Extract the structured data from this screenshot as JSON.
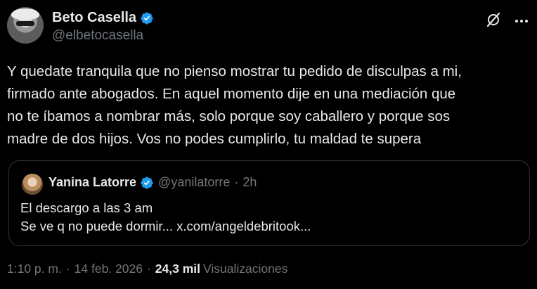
{
  "author": {
    "name": "Beto Casella",
    "handle": "@elbetocasella"
  },
  "tweet": {
    "text": "Y quedate tranquila que no pienso mostrar tu pedido de disculpas a mi,\nfirmado ante abogados. En aquel momento dije en una mediación que\nno te íbamos a nombrar más, solo porque soy caballero y porque sos\nmadre de dos hijos. Vos no podes cumplirlo, tu maldad te supera"
  },
  "quote": {
    "name": "Yanina Latorre",
    "handle": "@yanilatorre",
    "dot": "·",
    "time": "2h",
    "text": "El descargo a las 3 am\nSe ve q no puede dormir... x.com/angeldebritook..."
  },
  "meta": {
    "time": "1:10 p. m.",
    "sep1": "·",
    "date": "14 feb. 2026",
    "sep2": "·",
    "views_count": "24,3 mil",
    "views_label": "Visualizaciones"
  },
  "colors": {
    "background": "#000000",
    "text": "#e7e9ea",
    "muted": "#71767b",
    "verified": "#1d9bf0",
    "border": "#2f3336"
  },
  "icons": {
    "verified": "verified-badge-icon",
    "grok": "grok-icon",
    "more": "more-options-icon"
  }
}
